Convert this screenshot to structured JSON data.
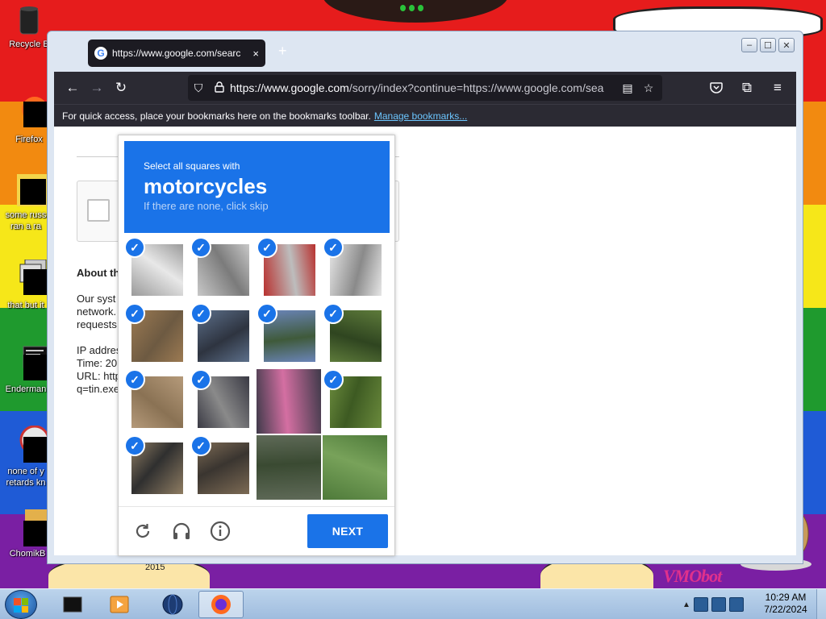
{
  "desktop": {
    "icons": [
      {
        "label": "Recycle B"
      },
      {
        "label": "Firefox"
      },
      {
        "label": "some russ\nran a ra"
      },
      {
        "label": "that but it"
      },
      {
        "label": "Enderman"
      },
      {
        "label": "none of y\nretards kn"
      },
      {
        "label": "ChomikB"
      }
    ],
    "year_label": "2015",
    "vm_label": "VMObot"
  },
  "browser": {
    "tab_title": "https://www.google.com/searc",
    "tab_close": "×",
    "new_tab": "+",
    "url_host": "https://www.google.com",
    "url_path": "/sorry/index?continue=https://www.google.com/sea",
    "bookmarks_text": "For quick access, place your bookmarks here on the bookmarks toolbar.",
    "bookmarks_link": "Manage bookmarks..."
  },
  "page": {
    "about_heading": "About th",
    "paragraph": "Our syst\nnetwork.\nrequests",
    "meta": "IP addres\nTime: 20\nURL: http\nq=tin.exe"
  },
  "captcha": {
    "instruction": "Select all squares with",
    "target": "motorcycles",
    "hint": "If there are none, click skip",
    "next_label": "NEXT",
    "tiles_selected": [
      true,
      true,
      true,
      true,
      true,
      true,
      true,
      true,
      true,
      true,
      false,
      true,
      true,
      true,
      false,
      false
    ],
    "check_glyph": "✓"
  },
  "taskbar": {
    "time": "10:29 AM",
    "date": "7/22/2024"
  },
  "colors": {
    "accent": "#1a73e8",
    "toolbar": "#2b2a33",
    "link": "#6cc6ff"
  }
}
